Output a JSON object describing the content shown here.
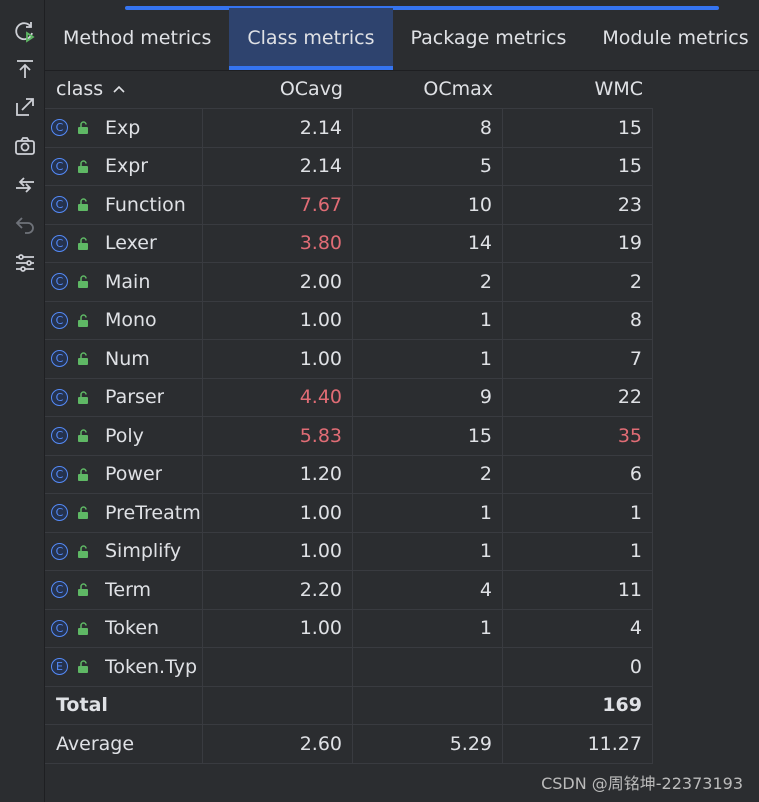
{
  "tabs": [
    {
      "label": "Method metrics",
      "active": false
    },
    {
      "label": "Class metrics",
      "active": true
    },
    {
      "label": "Package metrics",
      "active": false
    },
    {
      "label": "Module metrics",
      "active": false
    }
  ],
  "toolbar": [
    "refresh-run-icon",
    "export-icon",
    "open-external-icon",
    "camera-icon",
    "compare-icon",
    "undo-icon",
    "settings-sliders-icon"
  ],
  "table": {
    "headers": [
      "class",
      "OCavg",
      "OCmax",
      "WMC"
    ],
    "sort_indicator": "^",
    "rows": [
      {
        "kind": "C",
        "name": "Exp",
        "ocavg": "2.14",
        "ocmax": "8",
        "wmc": "15",
        "ocavg_red": false,
        "wmc_red": false
      },
      {
        "kind": "C",
        "name": "Expr",
        "ocavg": "2.14",
        "ocmax": "5",
        "wmc": "15",
        "ocavg_red": false,
        "wmc_red": false
      },
      {
        "kind": "C",
        "name": "Function",
        "ocavg": "7.67",
        "ocmax": "10",
        "wmc": "23",
        "ocavg_red": true,
        "wmc_red": false
      },
      {
        "kind": "C",
        "name": "Lexer",
        "ocavg": "3.80",
        "ocmax": "14",
        "wmc": "19",
        "ocavg_red": true,
        "wmc_red": false
      },
      {
        "kind": "C",
        "name": "Main",
        "ocavg": "2.00",
        "ocmax": "2",
        "wmc": "2",
        "ocavg_red": false,
        "wmc_red": false
      },
      {
        "kind": "C",
        "name": "Mono",
        "ocavg": "1.00",
        "ocmax": "1",
        "wmc": "8",
        "ocavg_red": false,
        "wmc_red": false
      },
      {
        "kind": "C",
        "name": "Num",
        "ocavg": "1.00",
        "ocmax": "1",
        "wmc": "7",
        "ocavg_red": false,
        "wmc_red": false
      },
      {
        "kind": "C",
        "name": "Parser",
        "ocavg": "4.40",
        "ocmax": "9",
        "wmc": "22",
        "ocavg_red": true,
        "wmc_red": false
      },
      {
        "kind": "C",
        "name": "Poly",
        "ocavg": "5.83",
        "ocmax": "15",
        "wmc": "35",
        "ocavg_red": true,
        "wmc_red": true
      },
      {
        "kind": "C",
        "name": "Power",
        "ocavg": "1.20",
        "ocmax": "2",
        "wmc": "6",
        "ocavg_red": false,
        "wmc_red": false
      },
      {
        "kind": "C",
        "name": "PreTreatm",
        "ocavg": "1.00",
        "ocmax": "1",
        "wmc": "1",
        "ocavg_red": false,
        "wmc_red": false
      },
      {
        "kind": "C",
        "name": "Simplify",
        "ocavg": "1.00",
        "ocmax": "1",
        "wmc": "1",
        "ocavg_red": false,
        "wmc_red": false
      },
      {
        "kind": "C",
        "name": "Term",
        "ocavg": "2.20",
        "ocmax": "4",
        "wmc": "11",
        "ocavg_red": false,
        "wmc_red": false
      },
      {
        "kind": "C",
        "name": "Token",
        "ocavg": "1.00",
        "ocmax": "1",
        "wmc": "4",
        "ocavg_red": false,
        "wmc_red": false
      },
      {
        "kind": "E",
        "name": "Token.Typ",
        "ocavg": "",
        "ocmax": "",
        "wmc": "0",
        "ocavg_red": false,
        "wmc_red": false
      }
    ],
    "total": {
      "label": "Total",
      "ocavg": "",
      "ocmax": "",
      "wmc": "169"
    },
    "average": {
      "label": "Average",
      "ocavg": "2.60",
      "ocmax": "5.29",
      "wmc": "11.27"
    }
  },
  "colors": {
    "accent": "#3574f0",
    "warning": "#e06c75",
    "icon_blue": "#548af7",
    "lock_green": "#5fb865"
  },
  "watermark": "CSDN @周铭坤-22373193"
}
